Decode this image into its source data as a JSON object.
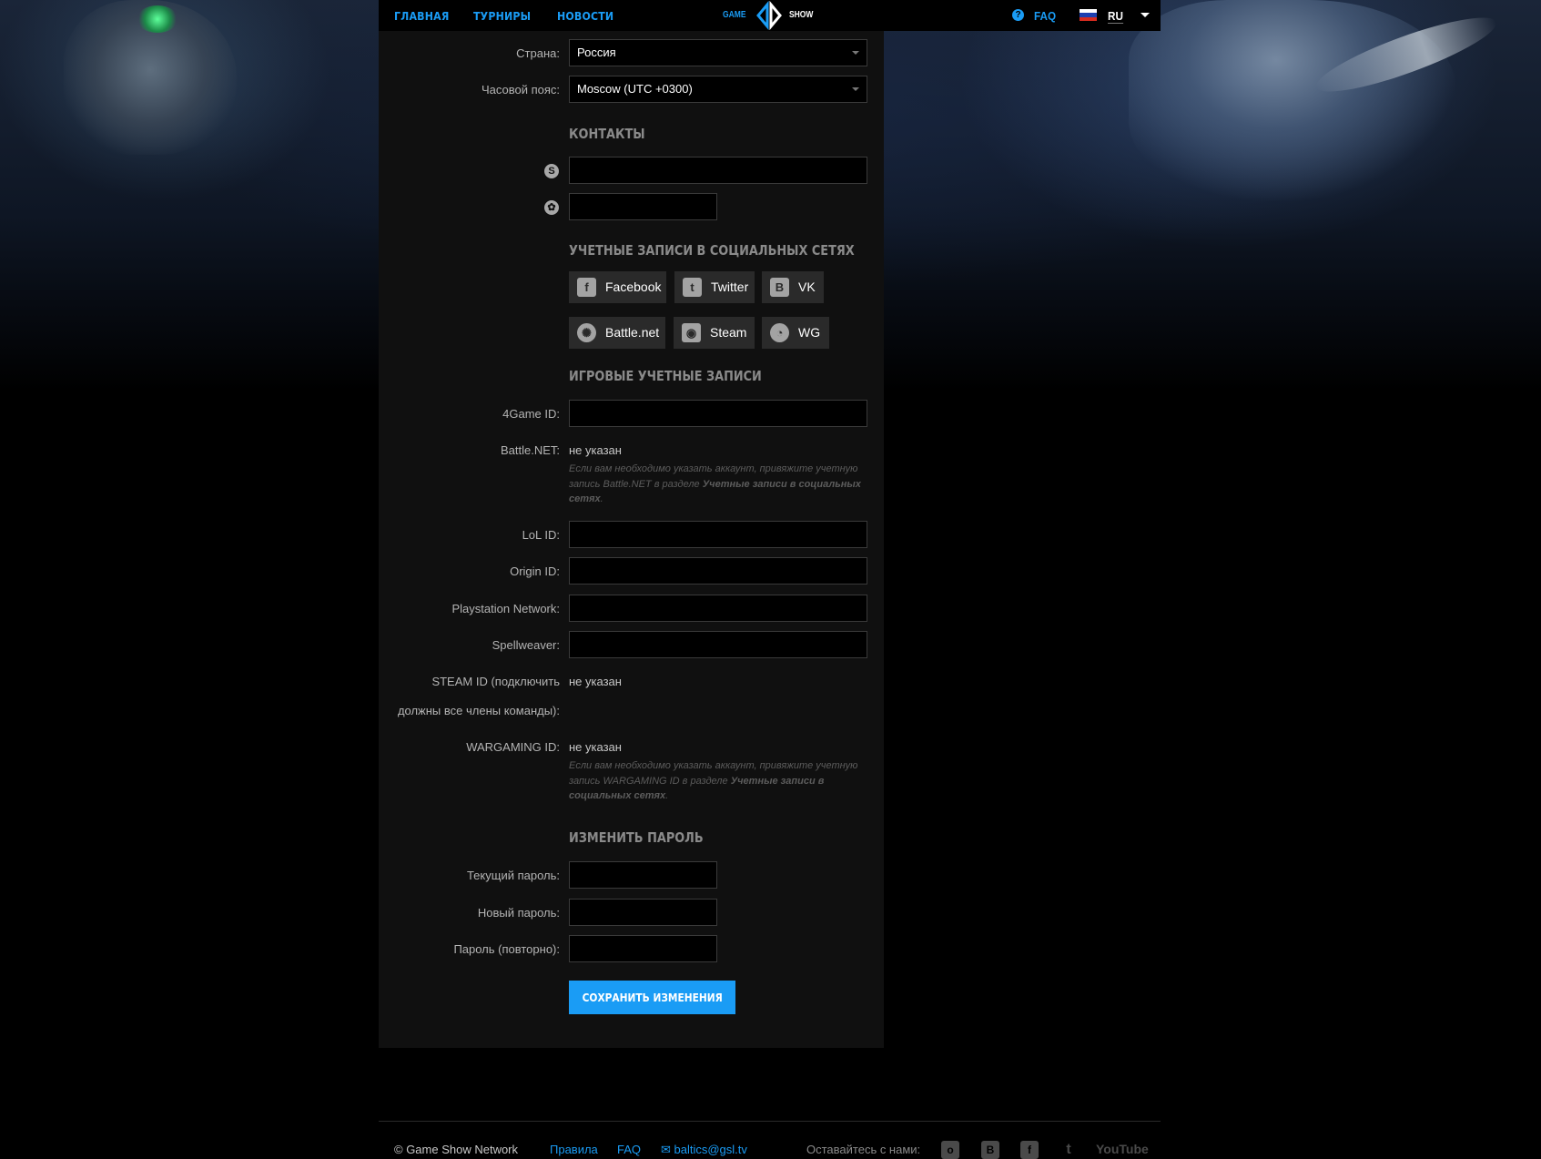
{
  "header": {
    "nav": [
      "ГЛАВНАЯ",
      "ТУРНИРЫ",
      "НОВОСТИ"
    ],
    "logo": {
      "left": "GAME",
      "right": "SHOW"
    },
    "faq": "FAQ",
    "lang": "RU"
  },
  "profile": {
    "country": {
      "label": "Страна:",
      "value": "Россия"
    },
    "timezone": {
      "label": "Часовой пояс:",
      "value": "Moscow (UTC +0300)"
    },
    "contacts": {
      "title": "КОНТАКТЫ",
      "skype": "",
      "icq": ""
    },
    "social": {
      "title": "УЧЕТНЫЕ ЗАПИСИ В СОЦИАЛЬНЫХ СЕТЯХ",
      "buttons": [
        "Facebook",
        "Twitter",
        "VK",
        "Battle.net",
        "Steam",
        "WG"
      ]
    },
    "game_accounts": {
      "title": "ИГРОВЫЕ УЧЕТНЫЕ ЗАПИСИ",
      "fourgame": {
        "label": "4Game ID:",
        "value": ""
      },
      "battlenet": {
        "label": "Battle.NET:",
        "value": "не указан",
        "hint_pre": "Если вам необходимо указать аккаунт, привяжите учетную запись Battle.NET в разделе ",
        "hint_bold": "Учетные записи в социальных сетях",
        "hint_post": "."
      },
      "lol": {
        "label": "LoL ID:",
        "value": ""
      },
      "origin": {
        "label": "Origin ID:",
        "value": ""
      },
      "psn": {
        "label": "Playstation Network:",
        "value": ""
      },
      "spellweaver": {
        "label": "Spellweaver:",
        "value": ""
      },
      "steam": {
        "label_line1": "STEAM ID (подключить",
        "label_line2": "должны все члены команды):",
        "value": "не указан"
      },
      "wargaming": {
        "label": "WARGAMING ID:",
        "value": "не указан",
        "hint_pre": "Если вам необходимо указать аккаунт, привяжите учетную запись WARGAMING ID в разделе ",
        "hint_bold": "Учетные записи в социальных сетях",
        "hint_post": "."
      }
    },
    "password": {
      "title": "ИЗМЕНИТЬ ПАРОЛЬ",
      "current": "Текущий пароль:",
      "new": "Новый пароль:",
      "repeat": "Пароль (повторно):"
    },
    "save": "СОХРАНИТЬ ИЗМЕНЕНИЯ"
  },
  "footer": {
    "copyright": "© Game Show Network",
    "links": [
      "Правила",
      "FAQ",
      "baltics@gsl.tv"
    ],
    "stay_connected": "Оставайтесь с нами:",
    "social_icons": [
      "odnoklassniki-icon",
      "vk-icon",
      "facebook-icon",
      "twitter-icon",
      "youtube-icon"
    ],
    "youtube": "YouTube"
  },
  "colors": {
    "accent": "#1a9cf5",
    "panel": "#101010",
    "field_border": "#3a3a3a"
  }
}
